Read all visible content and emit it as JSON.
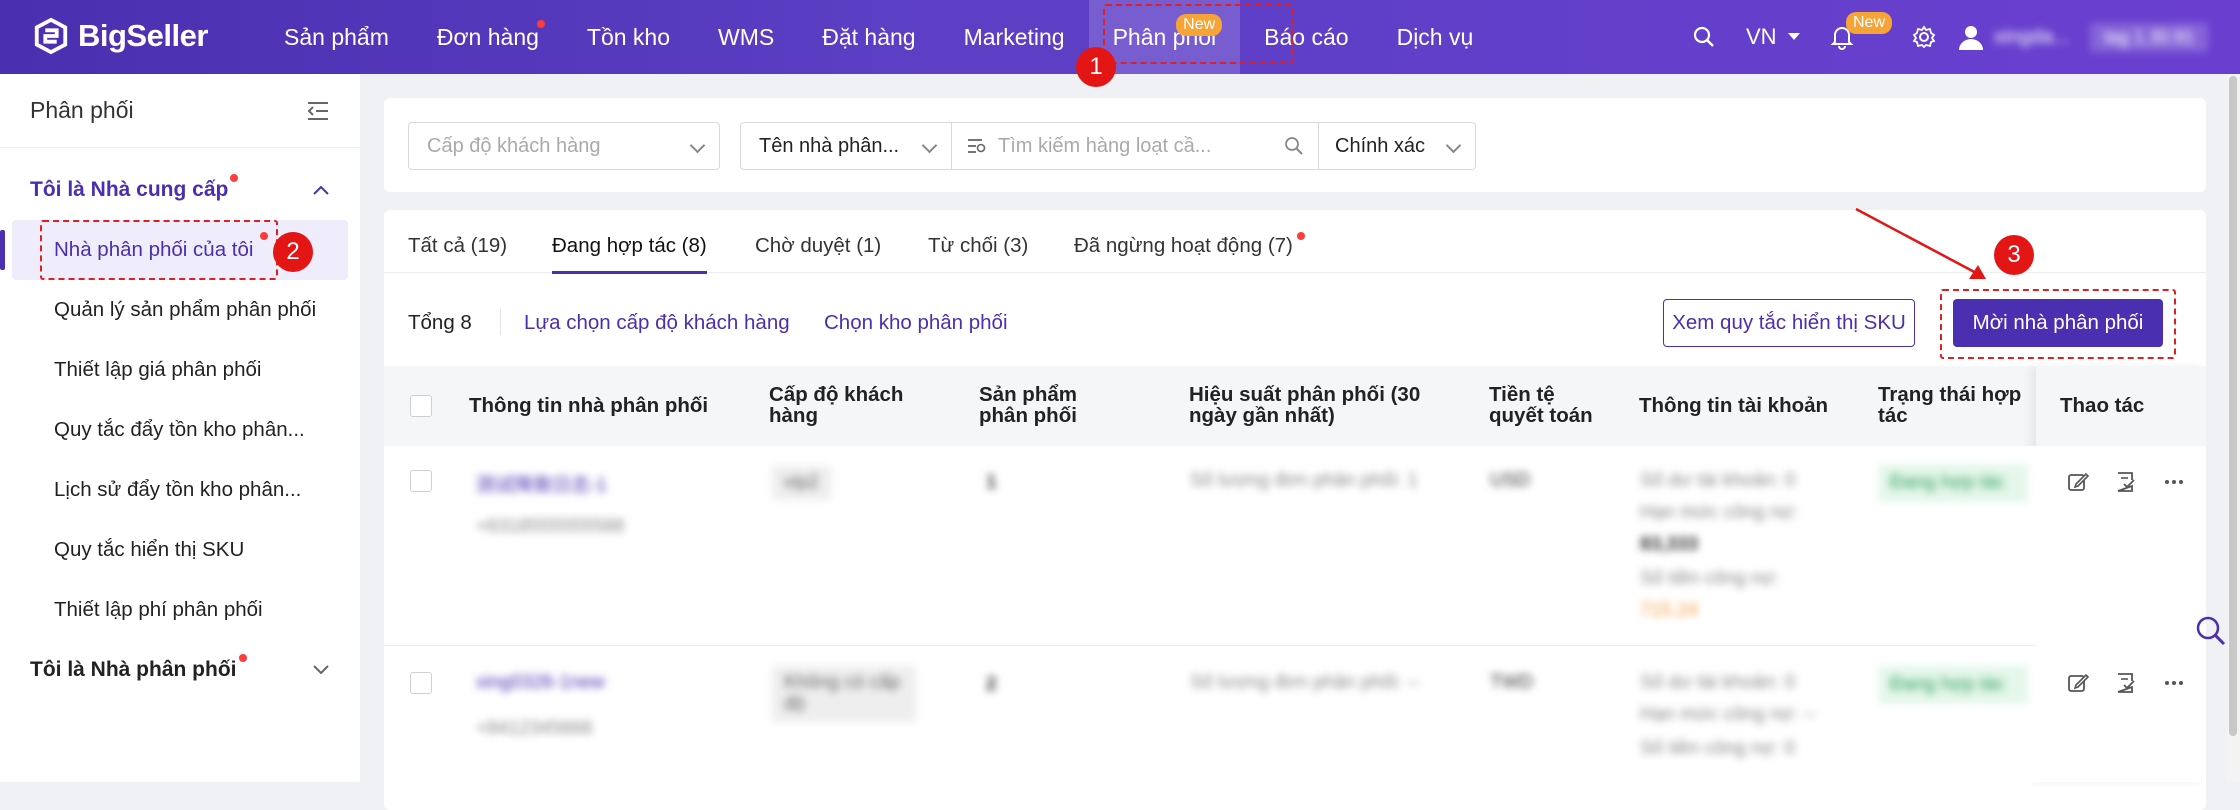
{
  "topbar": {
    "logo": "BigSeller",
    "nav": [
      "Sản phẩm",
      "Đơn hàng",
      "Tồn kho",
      "WMS",
      "Đặt hàng",
      "Marketing",
      "Phân phối",
      "Báo cáo",
      "Dịch vụ"
    ],
    "new_badge": "New",
    "language": "VN",
    "bell_badge": "New",
    "username": "xingda...",
    "version": "tag 1.30.91"
  },
  "sidebar": {
    "title": "Phân phối",
    "group1": "Tôi là Nhà cung cấp",
    "items": [
      "Nhà phân phối của tôi",
      "Quản lý sản phẩm phân phối",
      "Thiết lập giá phân phối",
      "Quy tắc đẩy tồn kho phân...",
      "Lịch sử đẩy tồn kho phân...",
      "Quy tắc hiển thị SKU",
      "Thiết lập phí phân phối"
    ],
    "group2": "Tôi là Nhà phân phối"
  },
  "filters": {
    "level_placeholder": "Cấp độ khách hàng",
    "name_select": "Tên nhà phân...",
    "search_placeholder": "Tìm kiếm hàng loạt cầ...",
    "match_select": "Chính xác"
  },
  "tabs": [
    "Tất cả (19)",
    "Đang hợp tác (8)",
    "Chờ duyệt (1)",
    "Từ chối (3)",
    "Đã ngừng hoạt động (7)"
  ],
  "toolbar": {
    "total": "Tổng 8",
    "select_level": "Lựa chọn cấp độ khách hàng",
    "select_warehouse": "Chọn kho phân phối",
    "view_rules": "Xem quy tắc hiển thị SKU",
    "invite": "Mời nhà phân phối"
  },
  "table": {
    "headers": [
      "Thông tin nhà phân phối",
      "Cấp độ khách hàng",
      "Sản phẩm phân phối",
      "Hiệu suất phân phối (30 ngày gần nhất)",
      "Tiền tệ quyết toán",
      "Thông tin tài khoản",
      "Trạng thái hợp tác",
      "Thao tác"
    ],
    "rows": [
      {
        "name": "测试降致日志-1",
        "phone": "+6318555555588",
        "level": "vip2",
        "products": "1",
        "perf": "Số lượng đơn phân phối: 1",
        "currency": "USD",
        "acc1": "Số dư tài khoản: 0",
        "acc2": "Hạn mức công nợ:",
        "acc3": "83,333",
        "acc4": "Số tiền công nợ:",
        "acc5": "715.24",
        "status": "Đang hợp tác"
      },
      {
        "name": "xing0326-1new",
        "phone": "+8412345666",
        "level": "Không có cấp độ",
        "products": "2",
        "perf": "Số lượng đơn phân phối: --",
        "currency": "TWD",
        "acc1": "Số dư tài khoản: 0",
        "acc2": "Hạn mức công nợ: --",
        "acc3": "",
        "acc4": "Số tiền công nợ: 0",
        "acc5": "",
        "status": "Đang hợp tác"
      }
    ]
  },
  "annotations": [
    "1",
    "2",
    "3"
  ],
  "colors": {
    "brand": "#4a2fb0",
    "annotation": "#e31515"
  }
}
